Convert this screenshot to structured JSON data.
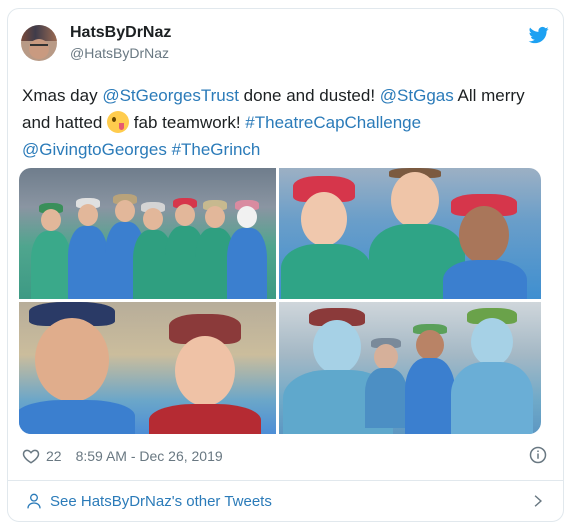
{
  "user": {
    "name": "HatsByDrNaz",
    "handle": "@HatsByDrNaz"
  },
  "tweet": {
    "segments": [
      {
        "type": "text",
        "value": "Xmas day "
      },
      {
        "type": "link",
        "value": "@StGeorgesTrust"
      },
      {
        "type": "text",
        "value": " done and dusted! "
      },
      {
        "type": "link",
        "value": "@StGgas"
      },
      {
        "type": "text",
        "value": " All merry and hatted "
      },
      {
        "type": "emoji",
        "value": "zany-face-emoji"
      },
      {
        "type": "text",
        "value": " fab teamwork! "
      },
      {
        "type": "link",
        "value": "#TheatreCapChallenge"
      },
      {
        "type": "text",
        "value": " "
      },
      {
        "type": "link",
        "value": "@GivingtoGeorges"
      },
      {
        "type": "text",
        "value": " "
      },
      {
        "type": "link",
        "value": "#TheGrinch"
      }
    ]
  },
  "photos": [
    {
      "name": "photo-team-group"
    },
    {
      "name": "photo-three-women-selfie"
    },
    {
      "name": "photo-two-men-selfie"
    },
    {
      "name": "photo-theatre-staff"
    }
  ],
  "meta": {
    "likes": "22",
    "timestamp": "8:59 AM - Dec 26, 2019"
  },
  "footer": {
    "see_more": "See HatsByDrNaz's other Tweets"
  },
  "icons": {
    "bird": "twitter-bird-icon",
    "heart": "heart-icon",
    "info": "info-icon",
    "person": "person-icon",
    "chevron": "chevron-right-icon"
  },
  "colors": {
    "link": "#2b7bb9",
    "muted": "#697882",
    "twitter_blue": "#1da1f2"
  }
}
